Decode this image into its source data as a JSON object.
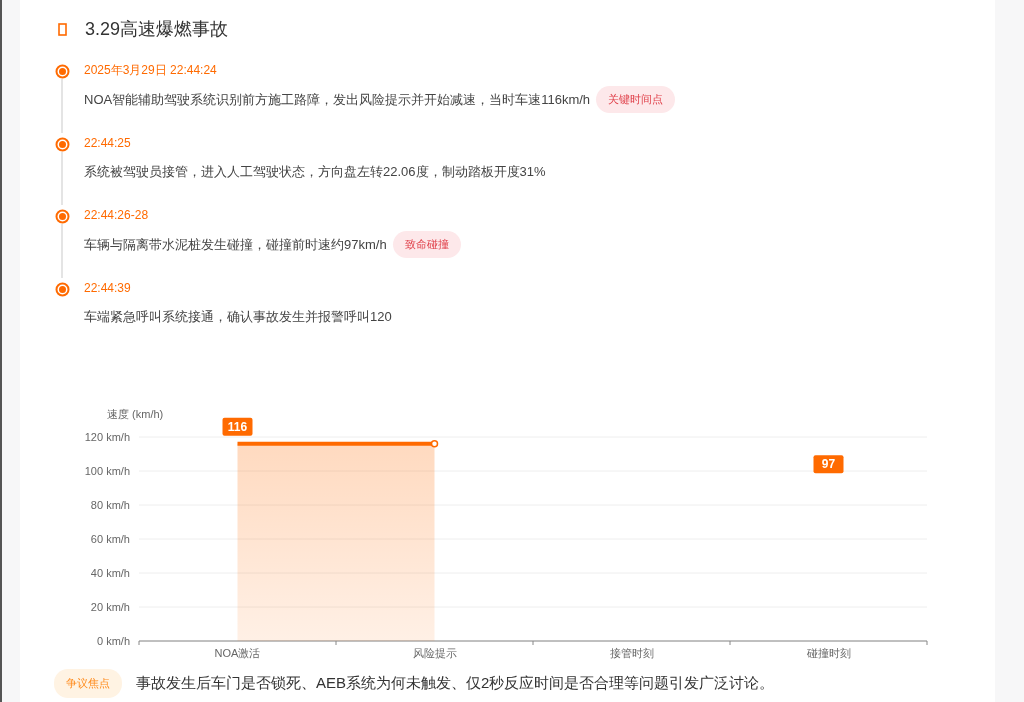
{
  "title": "3.29高速爆燃事故",
  "timeline": [
    {
      "time": "2025年3月29日 22:44:24",
      "text": "NOA智能辅助驾驶系统识别前方施工路障，发出风险提示并开始减速，当时车速116km/h",
      "tag": "关键时间点"
    },
    {
      "time": "22:44:25",
      "text": "系统被驾驶员接管，进入人工驾驶状态，方向盘左转22.06度，制动踏板开度31%"
    },
    {
      "time": "22:44:26-28",
      "text": "车辆与隔离带水泥桩发生碰撞，碰撞前时速约97km/h",
      "tag": "致命碰撞"
    },
    {
      "time": "22:44:39",
      "text": "车端紧急呼叫系统接通，确认事故发生并报警呼叫120"
    }
  ],
  "chart_data": {
    "type": "area",
    "ylabel": "速度 (km/h)",
    "categories": [
      "NOA激活",
      "风险提示",
      "接管时刻",
      "碰撞时刻"
    ],
    "series": [
      {
        "color": "#ff6a00",
        "values": [
          116,
          116,
          null,
          null
        ]
      }
    ],
    "annotations": [
      "97"
    ],
    "grid": true,
    "ylim": [
      0,
      120
    ],
    "yticks": [
      {
        "value": 0,
        "label": "0 km/h"
      },
      {
        "value": 20,
        "label": "20 km/h"
      },
      {
        "value": 40,
        "label": "40 km/h"
      },
      {
        "value": 60,
        "label": "60 km/h"
      },
      {
        "value": 80,
        "label": "80 km/h"
      },
      {
        "value": 100,
        "label": "100 km/h"
      },
      {
        "value": 120,
        "label": "120 km/h"
      }
    ],
    "value_labels": [
      "116",
      null,
      null,
      null
    ]
  },
  "footer": {
    "tag": "争议焦点",
    "text": "事故发生后车门是否锁死、AEB系统为何未触发、仅2秒反应时间是否合理等问题引发广泛讨论。"
  }
}
